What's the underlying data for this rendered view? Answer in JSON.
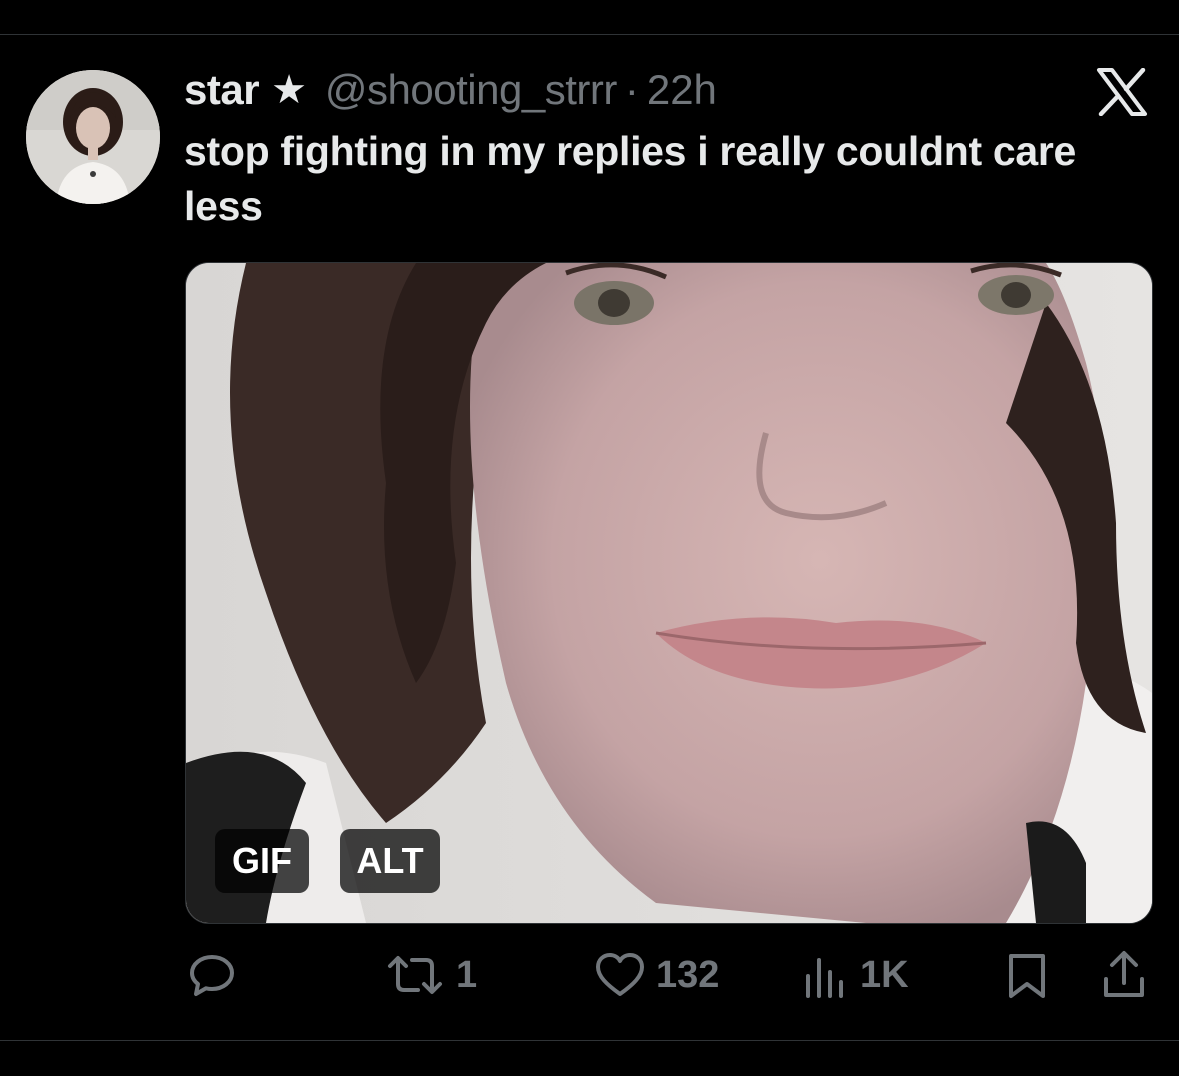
{
  "tweet": {
    "display_name": "star",
    "name_icon": "star-icon",
    "handle": "@shooting_strrr",
    "separator": "·",
    "time": "22h",
    "text": "stop fighting in my replies i really couldnt care less",
    "media": {
      "type": "gif",
      "badges": [
        "GIF",
        "ALT"
      ]
    },
    "actions": {
      "reply": {
        "icon": "reply-icon",
        "count": ""
      },
      "retweet": {
        "icon": "retweet-icon",
        "count": "1"
      },
      "like": {
        "icon": "heart-icon",
        "count": "132"
      },
      "views": {
        "icon": "views-chart-icon",
        "count": "1K"
      },
      "bookmark": {
        "icon": "bookmark-icon"
      },
      "share": {
        "icon": "share-icon"
      }
    }
  },
  "app_logo": "x-logo",
  "colors": {
    "background": "#000000",
    "text_primary": "#e7e9ea",
    "text_secondary": "#71767b",
    "divider": "#2f3336"
  }
}
